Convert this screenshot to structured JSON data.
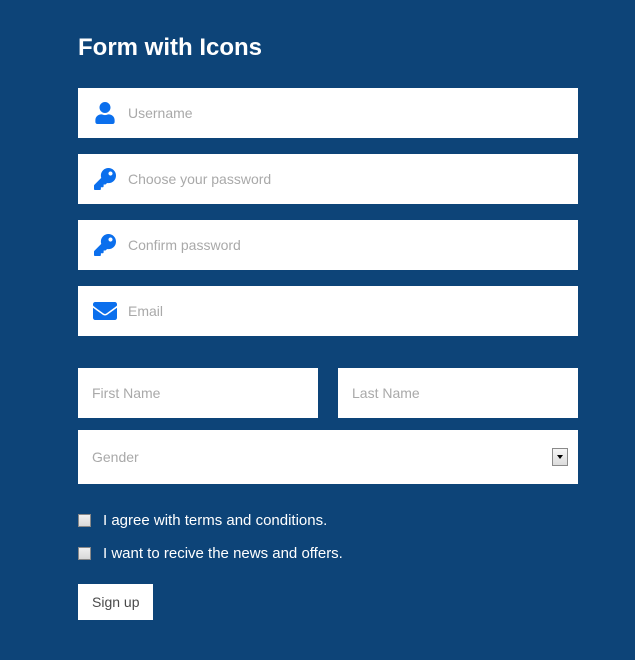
{
  "title": "Form with Icons",
  "fields": {
    "username": {
      "placeholder": "Username"
    },
    "password": {
      "placeholder": "Choose your password"
    },
    "confirm": {
      "placeholder": "Confirm password"
    },
    "email": {
      "placeholder": "Email"
    }
  },
  "name": {
    "first": {
      "placeholder": "First Name"
    },
    "last": {
      "placeholder": "Last Name"
    }
  },
  "gender": {
    "label": "Gender"
  },
  "checks": {
    "terms": "I agree with terms and conditions.",
    "news": "I want to recive the news and offers."
  },
  "submit": "Sign up",
  "colors": {
    "bg": "#0d4478",
    "accent": "#0b6fed"
  }
}
